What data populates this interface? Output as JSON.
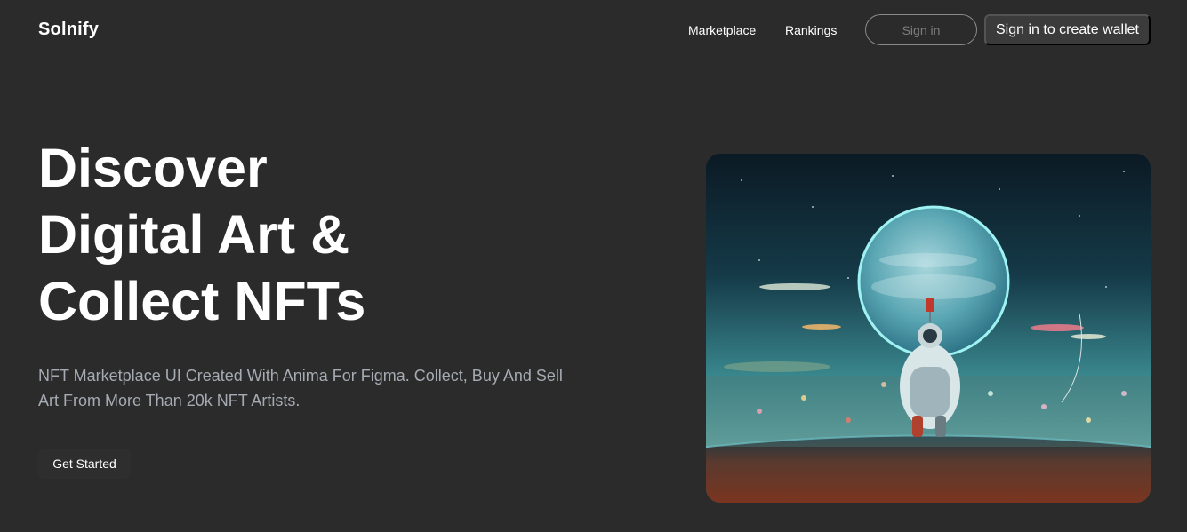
{
  "header": {
    "brand": "Solnify",
    "nav": {
      "marketplace": "Marketplace",
      "rankings": "Rankings"
    },
    "sign_in": "Sign in",
    "create_wallet": "Sign in to create wallet"
  },
  "hero": {
    "title_lines": [
      "Discover",
      "Digital Art &",
      "Collect NFTs"
    ],
    "subtitle": "NFT Marketplace UI Created With Anima For Figma. Collect, Buy And Sell Art From More Than 20k NFT Artists.",
    "cta": "Get Started"
  },
  "colors": {
    "background": "#2b2b2b",
    "subtitle_text": "#a6aab2",
    "button_dark": "#3b3b3b"
  }
}
